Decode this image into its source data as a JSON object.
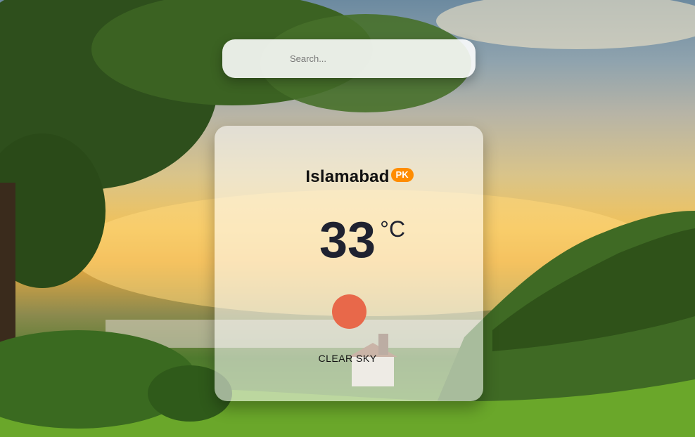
{
  "search": {
    "placeholder": "Search..."
  },
  "weather": {
    "city": "Islamabad",
    "country": "PK",
    "temperature": "33",
    "unit": "°C",
    "description": "CLEAR SKY",
    "icon": "sun-icon"
  },
  "colors": {
    "badge": "#ff8c00",
    "sun": "#e8684a",
    "temperature_text": "#1f2230"
  }
}
